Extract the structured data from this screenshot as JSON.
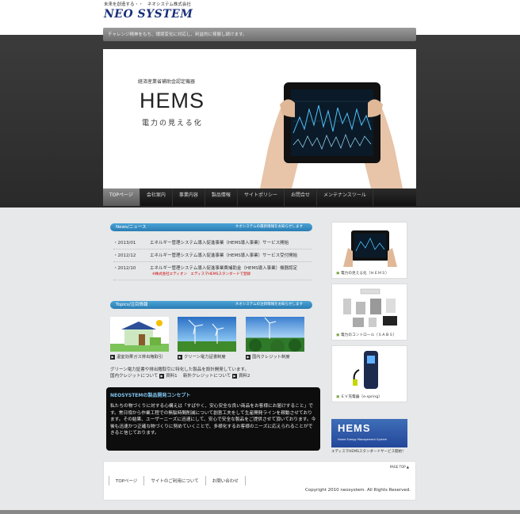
{
  "header": {
    "tagline": "未来を創造する・・　ネオシステム株式会社",
    "logo": "NEO SYSTEM",
    "subbar_text": "チャレンジ精神をもち、環境変化に対応し、利益的に発展し続けます。"
  },
  "hero": {
    "caption": "経済産業省補助金認定機器",
    "title": "HEMS",
    "subtitle": "電力の見える化"
  },
  "nav": {
    "items": [
      "TOPページ",
      "会社案内",
      "事業内容",
      "製品情報",
      "サイトポリシー",
      "お問合せ",
      "メンテナンスツール"
    ]
  },
  "news": {
    "title": "News/ニュース",
    "right": "ネオシステムの最新情報をお知らせします",
    "items": [
      {
        "date": "・2013/01",
        "text": "エネルギー管理システム導入促進事業（HEMS導入事業）サービス開始"
      },
      {
        "date": "・2012/12",
        "text": "エネルギー管理システム導入促進事業（HEMS導入事業）サービス受付開始"
      },
      {
        "date": "・2012/10",
        "text": "エネルギー管理システム導入促進事業費補助金（HEMS導入事業）機器認定",
        "note": "※株式会社エディオン　エディスマHEMSスタンダードで登録"
      }
    ]
  },
  "topics": {
    "title": "Topics/注目情報",
    "right": "ネオシステムの注目情報をお知らせします",
    "items": [
      {
        "label": "温室効果ガス排出権取引"
      },
      {
        "label": "クリーン電力証書制度"
      },
      {
        "label": "国内クレジット制度"
      }
    ],
    "desc": "グリーン電力証書や排出権取引に特化した製品を設計開発しています。",
    "links_prefix": "国内クレジットについて",
    "link1": "資料1",
    "links_mid": "　新外クレジットについて",
    "link2": "資料2"
  },
  "concept": {
    "heading": "NEOSYSTEMの製品開発コンセプト",
    "body": "私たちの物づくりに対する心構えは「すばやく、安心安全な良い商品をお客様にお届けすること」です。常日頃から作業工程での無駄時間削減について創意工夫をして生産開発ラインを稼動させております。その結果、ユーザーニーズに迅速にして、安心で安全な製品をご提供させて頂いております。今後も迅速かつ正確な物づくりに努めていくことで、多様化するお客様のニーズに応えられることができると信じております。"
  },
  "sidebar": {
    "cards": [
      {
        "label": "電力の見える化（ＨＥＭＳ）"
      },
      {
        "label": "電力のコントロール（ＳＡＢＳ）"
      },
      {
        "label": "ＥＶ充電器（e-spring）"
      }
    ],
    "banner_title": "HEMS",
    "banner_sub": "Home Energy Management System",
    "banner_caption": "エディスマHEMSスタンダードサービス開始！"
  },
  "footer": {
    "pagetop": "PAGE TOP ▲",
    "links": [
      "TOPページ",
      "サイトのご利用について",
      "お問い合わせ"
    ],
    "copyright": "Copyright 2010 neosystem. All Rights Reserved."
  }
}
